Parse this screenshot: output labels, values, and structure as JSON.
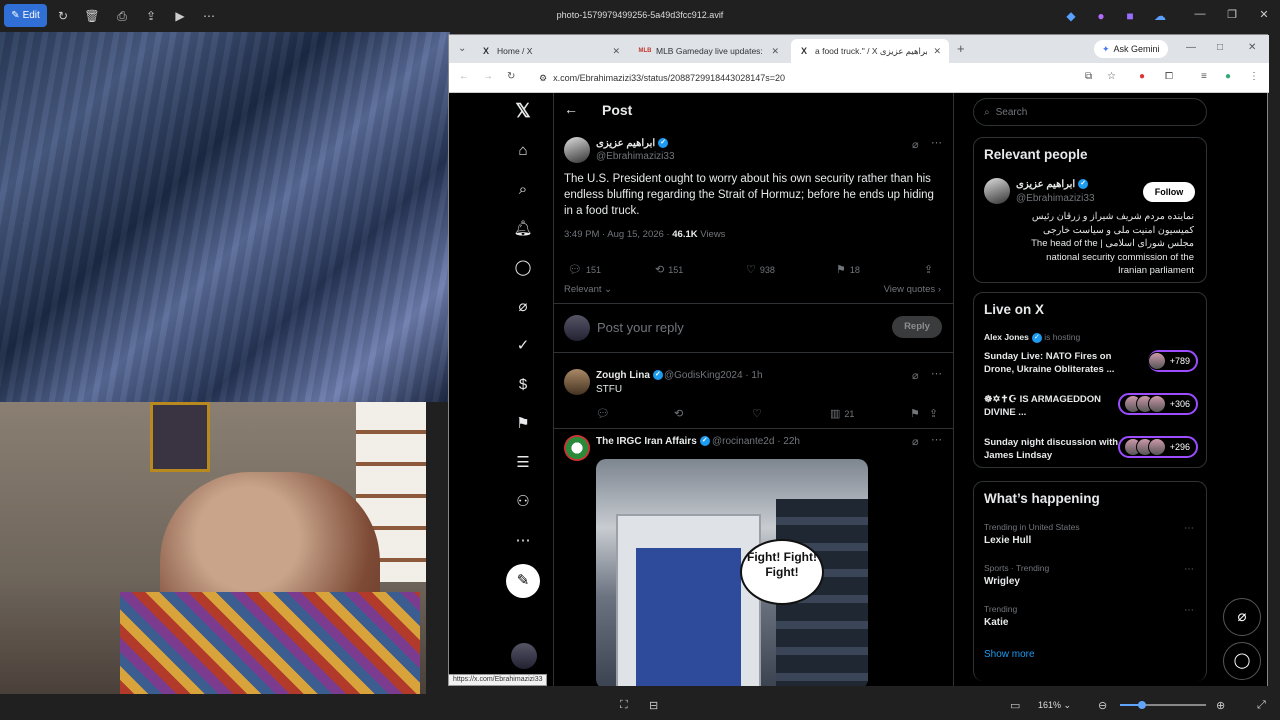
{
  "photos_app": {
    "edit_label": "Edit",
    "title": "photo-1579979499256-5a49d3fcc912.avif",
    "zoom_level": "161%",
    "zoom_fraction": 0.25,
    "status_url": "https://x.com/Ebrahimazizi33"
  },
  "browser": {
    "tabs": [
      {
        "label": "Home / X",
        "favicon": "X"
      },
      {
        "label": "MLB Gameday live updates: Ca",
        "favicon": "MLB"
      },
      {
        "label": "a food truck.\" / X ابراهیم عزیزی",
        "favicon": "X"
      }
    ],
    "gemini_label": "Ask Gemini",
    "url": "x.com/Ebrahimazizi33/status/2088729918443028147s=20"
  },
  "x": {
    "post_header": "Post",
    "tweet": {
      "author_name": "ابراهیم عزیزی",
      "author_handle": "@Ebrahimazizi33",
      "text": "The U.S. President ought to worry about his own security rather than his endless bluffing regarding the Strait of Hormuz; before he ends up hiding in a food truck.",
      "time": "3:49 PM · Aug 15, 2026 ·",
      "views_count": "46.1K",
      "views_label": "Views",
      "replies": "151",
      "reposts": "151",
      "likes": "938",
      "bookmarks": "18"
    },
    "sort_label": "Relevant",
    "view_quotes": "View quotes",
    "reply_placeholder": "Post your reply",
    "reply_button": "Reply",
    "replies": [
      {
        "name": "Zough Lina",
        "handle": "@GodisKing2024 · 1h",
        "text": "STFU",
        "views": "21"
      },
      {
        "name": "The IRGC Iran Affairs",
        "handle": "@rocinante2d · 22h",
        "media_text": "Fight! Fight! Fight!"
      }
    ],
    "search_placeholder": "Search",
    "relevant_people": {
      "title": "Relevant people",
      "name": "ابراهیم عزیزی",
      "handle": "@Ebrahimazizi33",
      "follow": "Follow",
      "bio_line1": "نماینده مردم شریف شیراز و زرقان رئیس",
      "bio_line2": "کمیسیون امنیت ملی و سیاست خارجی",
      "bio_line3": "مجلس شورای اسلامی | The head of the",
      "bio_line4": "national security commission of the",
      "bio_line5": "Iranian parliament"
    },
    "live": {
      "title": "Live on X",
      "host_name": "Alex Jones",
      "host_suffix": "is hosting",
      "items": [
        {
          "title": "Sunday Live: NATO Fires on Drone, Ukraine Obliterates ...",
          "count": "+789"
        },
        {
          "title": "☸✡✝☪ IS ARMAGEDDON DIVINE ...",
          "count": "+306"
        },
        {
          "title": "Sunday night discussion with James Lindsay",
          "count": "+296"
        }
      ]
    },
    "happening": {
      "title": "What’s happening",
      "trends": [
        {
          "meta": "Trending in United States",
          "name": "Lexie Hull"
        },
        {
          "meta": "Sports · Trending",
          "name": "Wrigley"
        },
        {
          "meta": "Trending",
          "name": "Katie"
        }
      ],
      "show_more": "Show more"
    }
  }
}
